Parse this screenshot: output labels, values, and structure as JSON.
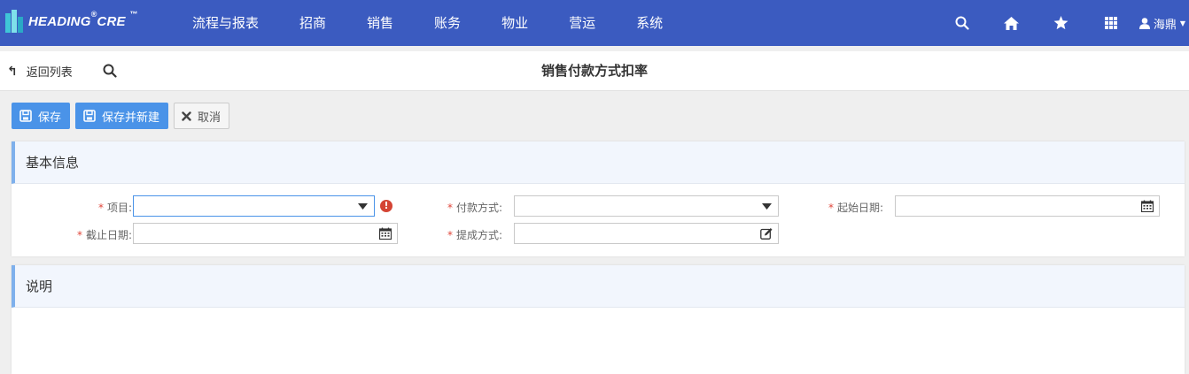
{
  "app": {
    "logo_text": "HEADING",
    "logo_reg": "®",
    "logo_suffix": "CRE",
    "logo_tm": "™"
  },
  "nav": {
    "items": [
      "流程与报表",
      "招商",
      "销售",
      "账务",
      "物业",
      "营运",
      "系统"
    ],
    "user_name": "海鼎",
    "icons": [
      "search-icon",
      "home-icon",
      "star-icon",
      "apps-grid-icon",
      "user-icon"
    ]
  },
  "titlebar": {
    "back_label": "返回列表",
    "title": "销售付款方式扣率"
  },
  "toolbar": {
    "save_label": "保存",
    "save_new_label": "保存并新建",
    "cancel_label": "取消"
  },
  "basic_info": {
    "heading": "基本信息",
    "project_label": "项目:",
    "payment_method_label": "付款方式:",
    "start_date_label": "起始日期:",
    "end_date_label": "截止日期:",
    "commission_method_label": "提成方式:",
    "project_value": "",
    "payment_method_value": "",
    "start_date_value": "",
    "end_date_value": "",
    "commission_method_value": "",
    "required_mark": "*",
    "error_mark": "!"
  },
  "description": {
    "heading": "说明"
  },
  "colors": {
    "nav_bg": "#3b5bc0",
    "primary_button": "#4a93e8",
    "required": "#e0463a",
    "error": "#d44434",
    "panel_accent": "#7eb0ec"
  }
}
